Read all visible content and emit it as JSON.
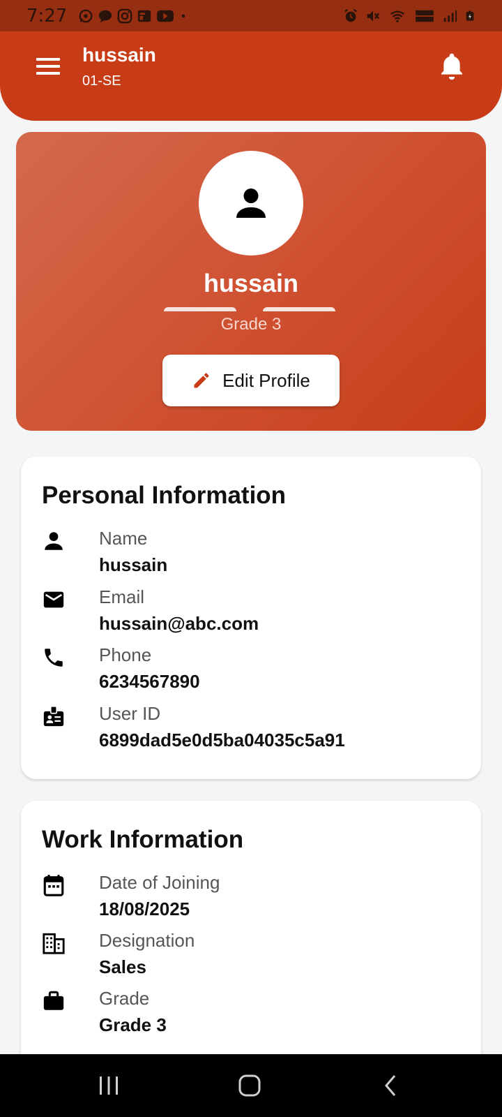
{
  "status_bar": {
    "time": "7:27",
    "left_icons": [
      "whatsapp-icon",
      "chat-icon",
      "instagram-icon",
      "news-icon",
      "youtube-icon",
      "dot-icon"
    ],
    "right_icons": [
      "alarm-icon",
      "mute-icon",
      "wifi-icon",
      "volte-icon",
      "signal-icon",
      "battery-icon"
    ]
  },
  "app_bar": {
    "title": "hussain",
    "subtitle": "01-SE",
    "menu_icon": "menu-icon",
    "notification_icon": "bell-icon"
  },
  "profile": {
    "name": "hussain",
    "grade": "Grade 3",
    "edit_button_label": "Edit Profile",
    "avatar_icon": "person-icon"
  },
  "personal_info": {
    "title": "Personal Information",
    "rows": [
      {
        "icon": "person-icon",
        "label": "Name",
        "value": "hussain"
      },
      {
        "icon": "email-icon",
        "label": "Email",
        "value": "hussain@abc.com"
      },
      {
        "icon": "phone-icon",
        "label": "Phone",
        "value": "6234567890"
      },
      {
        "icon": "badge-icon",
        "label": "User ID",
        "value": "6899dad5e0d5ba04035c5a91"
      }
    ]
  },
  "work_info": {
    "title": "Work Information",
    "rows": [
      {
        "icon": "calendar-icon",
        "label": "Date of Joining",
        "value": "18/08/2025"
      },
      {
        "icon": "building-icon",
        "label": "Designation",
        "value": "Sales"
      },
      {
        "icon": "briefcase-icon",
        "label": "Grade",
        "value": "Grade 3"
      }
    ]
  },
  "colors": {
    "primary": "#c73c16",
    "status_bar": "#962e12",
    "card_gradient_start": "#d4694c",
    "card_gradient_end": "#c63e18",
    "background": "#f4f5f7"
  },
  "nav_bar": {
    "icons": [
      "recent-apps-icon",
      "home-icon",
      "back-icon"
    ]
  }
}
